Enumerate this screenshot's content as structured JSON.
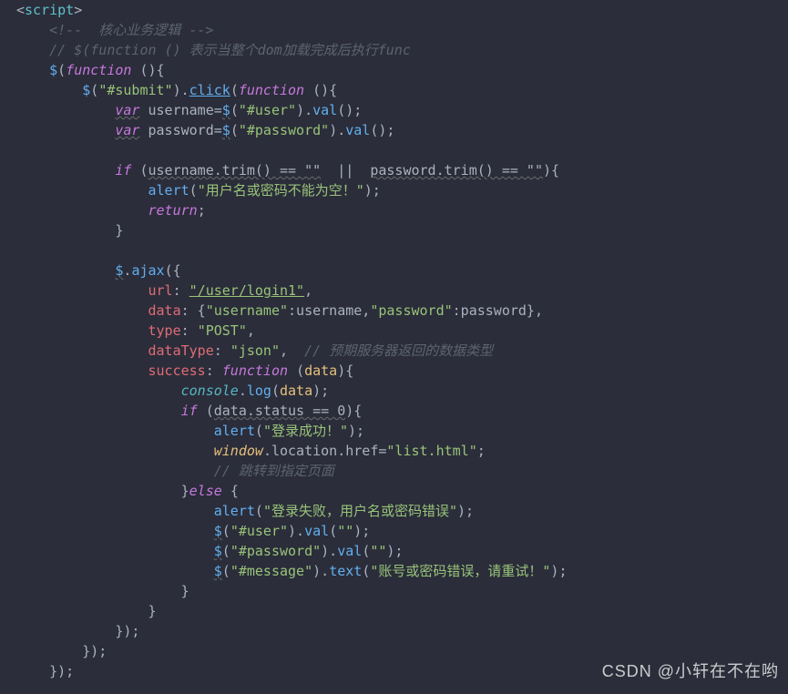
{
  "l01a": "<",
  "l01b": "script",
  "l01c": ">",
  "l02": "    <!--  核心业务逻辑 -->",
  "l03": "    // $(function () 表示当整个dom加载完成后执行func",
  "l04a": "    ",
  "l04b": "$",
  "l04c": "(",
  "l04d": "function ",
  "l04e": "(){",
  "l05a": "        ",
  "l05b": "$",
  "l05c": "(",
  "l05d": "\"#submit\"",
  "l05e": ").",
  "l05f": "click",
  "l05g": "(",
  "l05h": "function ",
  "l05i": "(){",
  "l06a": "            ",
  "l06b": "var",
  "l06c": " username",
  "l06d": "=",
  "l06e": "$",
  "l06f": "(",
  "l06g": "\"#user\"",
  "l06h": ").",
  "l06i": "val",
  "l06j": "();",
  "l07a": "            ",
  "l07b": "var",
  "l07c": " password",
  "l07d": "=",
  "l07e": "$",
  "l07f": "(",
  "l07g": "\"#password\"",
  "l07h": ").",
  "l07i": "val",
  "l07j": "();",
  "l08": " ",
  "l09a": "            ",
  "l09b": "if ",
  "l09c": "(",
  "l09d": "username.trim() == \"\"",
  "l09e": "  ||  ",
  "l09f": "password.trim() == \"\"",
  "l09g": "){",
  "l10a": "                ",
  "l10b": "alert",
  "l10c": "(",
  "l10d": "\"用户名或密码不能为空！\"",
  "l10e": ");",
  "l11a": "                ",
  "l11b": "return",
  "l11c": ";",
  "l12": "            }",
  "l13": " ",
  "l14a": "            ",
  "l14b": "$",
  "l14c": ".",
  "l14d": "ajax",
  "l14e": "({",
  "l15a": "                url",
  "l15b": ": ",
  "l15c": "\"/user/login1\"",
  "l15d": ",",
  "l16a": "                data",
  "l16b": ": {",
  "l16c": "\"username\"",
  "l16d": ":username,",
  "l16e": "\"password\"",
  "l16f": ":password},",
  "l17a": "                type",
  "l17b": ": ",
  "l17c": "\"POST\"",
  "l17d": ",",
  "l18a": "                dataType",
  "l18b": ": ",
  "l18c": "\"json\"",
  "l18d": ",  ",
  "l18e": "// 预期服务器返回的数据类型",
  "l19a": "                success",
  "l19b": ": ",
  "l19c": "function ",
  "l19d": "(",
  "l19e": "data",
  "l19f": "){",
  "l20a": "                    ",
  "l20b": "console",
  "l20c": ".",
  "l20d": "log",
  "l20e": "(",
  "l20f": "data",
  "l20g": ");",
  "l21a": "                    ",
  "l21b": "if ",
  "l21c": "(",
  "l21d": "data.status == 0",
  "l21e": "){",
  "l22a": "                        ",
  "l22b": "alert",
  "l22c": "(",
  "l22d": "\"登录成功！\"",
  "l22e": ");",
  "l23a": "                        ",
  "l23b": "window",
  "l23c": ".location.href",
  "l23d": "=",
  "l23e": "\"list.html\"",
  "l23f": ";",
  "l24a": "                        ",
  "l24b": "// 跳转到指定页面",
  "l25a": "                    }",
  "l25b": "else ",
  "l25c": "{",
  "l26a": "                        ",
  "l26b": "alert",
  "l26c": "(",
  "l26d": "\"登录失败，用户名或密码错误\"",
  "l26e": ");",
  "l27a": "                        ",
  "l27b": "$",
  "l27c": "(",
  "l27d": "\"#user\"",
  "l27e": ").",
  "l27f": "val",
  "l27g": "(",
  "l27h": "\"\"",
  "l27i": ");",
  "l28a": "                        ",
  "l28b": "$",
  "l28c": "(",
  "l28d": "\"#password\"",
  "l28e": ").",
  "l28f": "val",
  "l28g": "(",
  "l28h": "\"\"",
  "l28i": ");",
  "l29a": "                        ",
  "l29b": "$",
  "l29c": "(",
  "l29d": "\"#message\"",
  "l29e": ").",
  "l29f": "text",
  "l29g": "(",
  "l29h": "\"账号或密码错误，请重试！\"",
  "l29i": ");",
  "l30": "                    }",
  "l31": "                }",
  "l32": "            });",
  "l33": "        });",
  "l34": "    });",
  "watermark": "CSDN @小轩在不在哟"
}
